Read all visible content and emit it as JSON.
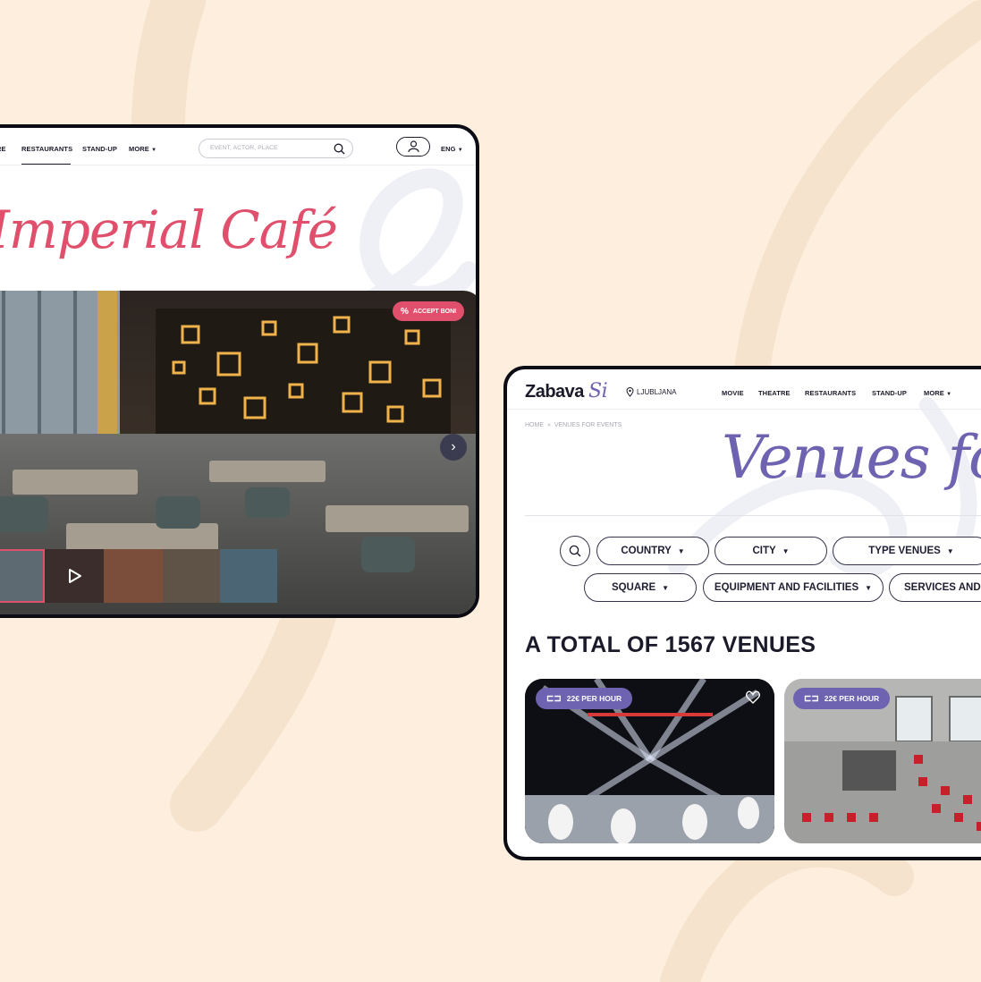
{
  "colors": {
    "background": "#fdeedd",
    "accent_pink": "#e0506c",
    "accent_purple": "#6d63b0",
    "text_dark": "#1a1a2a"
  },
  "restaurant_page": {
    "nav": {
      "items": [
        "RE",
        "RESTAURANTS",
        "STAND-UP",
        "MORE"
      ],
      "active": "RESTAURANTS"
    },
    "search": {
      "placeholder": "EVENT, ACTOR, PLACE",
      "icon": "search-icon"
    },
    "user_icon": "user-icon",
    "language": "ENG",
    "title": "Imperial Café",
    "badge": "ACCEPT BONI",
    "gallery": {
      "thumbnail_count": 5,
      "video_icon": "play-icon",
      "next_icon": "chevron-right-icon"
    }
  },
  "venues_page": {
    "logo": {
      "text": "Zabava",
      "suffix": "Si"
    },
    "location": "LJUBLJANA",
    "nav": {
      "items": [
        "MOVIE",
        "THEATRE",
        "RESTAURANTS",
        "STAND-UP",
        "MORE"
      ]
    },
    "breadcrumb": {
      "home": "HOME",
      "separator": "»",
      "current": "VENUES FOR EVENTS"
    },
    "title": "Venues for e",
    "filters": {
      "row1": [
        "COUNTRY",
        "CITY",
        "TYPE VENUES"
      ],
      "row2": [
        "SQUARE",
        "EQUIPMENT AND FACILITIES",
        "SERVICES AND C"
      ]
    },
    "total_heading": "A TOTAL OF 1567 VENUES",
    "cards": [
      {
        "price": "22€ PER HOUR",
        "favorite_icon": "heart-icon"
      },
      {
        "price": "22€ PER HOUR"
      }
    ]
  }
}
